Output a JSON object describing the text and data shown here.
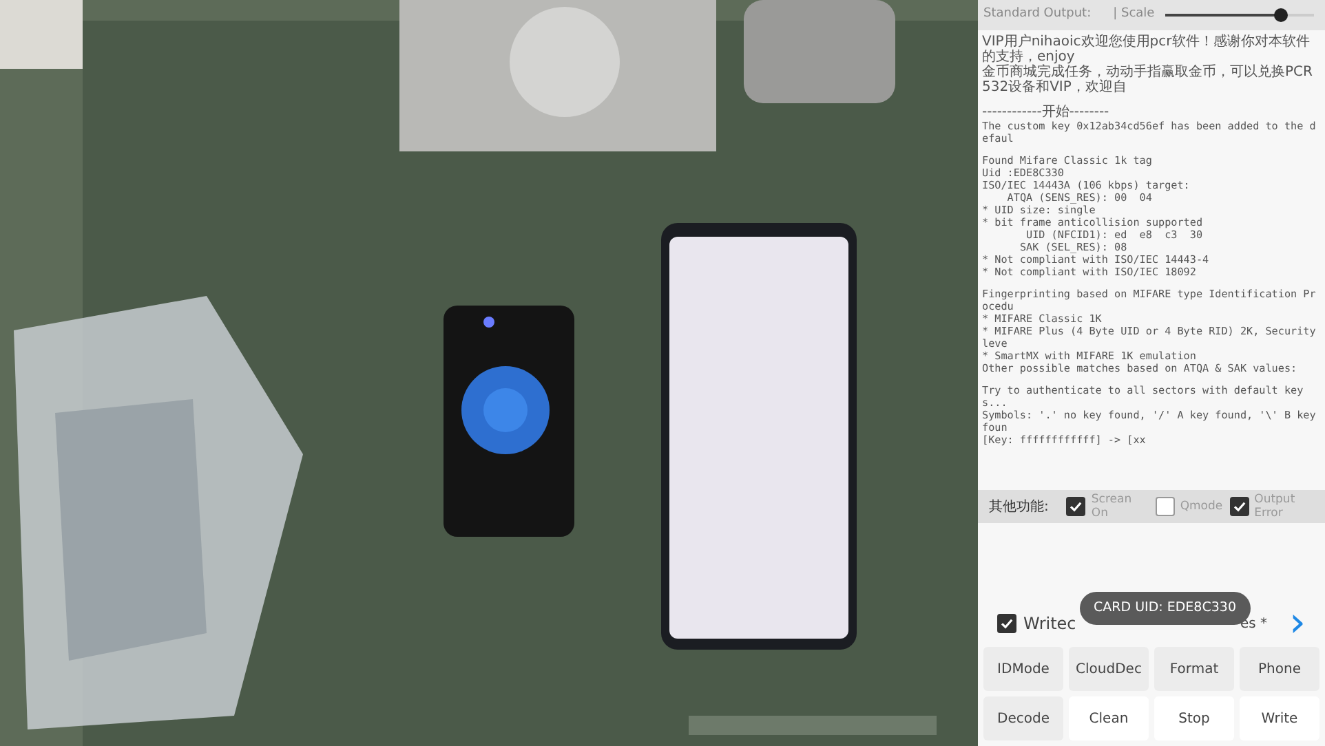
{
  "top_bar": {
    "output_label": "Standard Output:",
    "scale_label": "| Scale",
    "scale": {
      "level": 0.78
    }
  },
  "log": {
    "blocks": [
      [
        "VIP用户nihaoic欢迎您使用pcr软件！感谢你对本软件的支持，enjoy",
        "金币商城完成任务，动动手指赢取金币，可以兑换PCR532设备和VIP，欢迎自"
      ],
      [
        "------------开始--------",
        "The custom key 0x12ab34cd56ef has been added to the defaul"
      ],
      [
        "Found Mifare Classic 1k tag",
        "Uid :EDE8C330",
        "ISO/IEC 14443A (106 kbps) target:",
        "    ATQA (SENS_RES): 00  04",
        "* UID size: single",
        "* bit frame anticollision supported",
        "       UID (NFCID1): ed  e8  c3  30",
        "      SAK (SEL_RES): 08",
        "* Not compliant with ISO/IEC 14443-4",
        "* Not compliant with ISO/IEC 18092"
      ],
      [
        "Fingerprinting based on MIFARE type Identification Procedu",
        "* MIFARE Classic 1K",
        "* MIFARE Plus (4 Byte UID or 4 Byte RID) 2K, Security leve",
        "* SmartMX with MIFARE 1K emulation",
        "Other possible matches based on ATQA & SAK values:"
      ],
      [
        "Try to authenticate to all sectors with default keys...",
        "Symbols: '.' no key found, '/' A key found, '\\' B key foun",
        "[Key: ffffffffffff] -> [xx"
      ]
    ]
  },
  "options": {
    "label": "其他功能:",
    "checkboxes": [
      {
        "label": "Screan On",
        "checked": true
      },
      {
        "label": "Qmode",
        "checked": false
      },
      {
        "label": "Output Error",
        "checked": true
      }
    ]
  },
  "write_row": {
    "checkbox": {
      "label": "Writec",
      "checked": true
    },
    "tail": "es *",
    "next": "›"
  },
  "toast": "CARD UID: EDE8C330",
  "buttons": [
    {
      "label": "IDMode",
      "active": false
    },
    {
      "label": "CloudDec",
      "active": false
    },
    {
      "label": "Format",
      "active": false
    },
    {
      "label": "Phone",
      "active": false
    },
    {
      "label": "Decode",
      "active": false
    },
    {
      "label": "Clean",
      "active": true
    },
    {
      "label": "Stop",
      "active": true
    },
    {
      "label": "Write",
      "active": true
    }
  ]
}
